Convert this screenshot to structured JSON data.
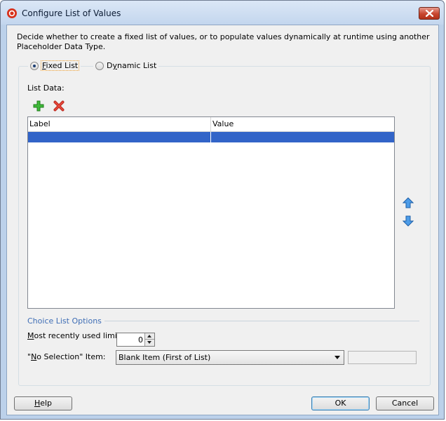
{
  "window": {
    "title": "Configure List of Values"
  },
  "description": "Decide whether to create a fixed list of values, or to populate values dynamically at runtime using another Placeholder Data Type.",
  "mode": {
    "fixed_list_label": "Fixed List",
    "dynamic_list_label": "Dynamic List",
    "selected": "Fixed List"
  },
  "list_data": {
    "label": "List Data:",
    "columns": [
      "Label",
      "Value"
    ],
    "rows": [
      {
        "label": "",
        "value": ""
      }
    ],
    "selected_row": 0
  },
  "choice_list_options": {
    "title": "Choice List Options",
    "mru_label": "Most recently used limit:",
    "mru_value": "0",
    "no_selection_label": "\"No Selection\" Item:",
    "no_selection_value": "Blank Item (First of List)"
  },
  "buttons": {
    "help": "Help",
    "ok": "OK",
    "cancel": "Cancel"
  },
  "icons": {
    "app": "oracle-app-icon",
    "add": "add-icon",
    "delete": "delete-icon",
    "move_up": "arrow-up-icon",
    "move_down": "arrow-down-icon",
    "close": "close-icon"
  },
  "colors": {
    "selection": "#3264c8",
    "section_title": "#3e6db5",
    "close_button": "#c8462f"
  }
}
